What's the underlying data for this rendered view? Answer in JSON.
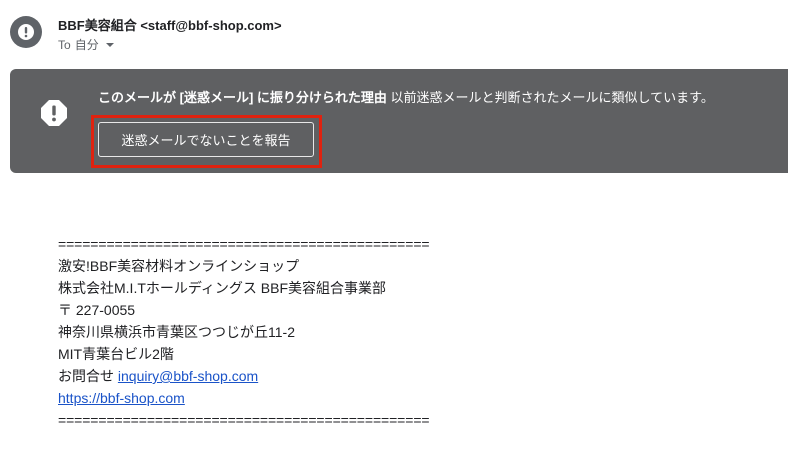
{
  "email": {
    "sender": "BBF美容組合 <staff@bbf-shop.com>",
    "to_prefix": "To",
    "to_recipient": "自分"
  },
  "spam_banner": {
    "reason_bold": "このメールが [迷惑メール] に振り分けられた理由",
    "reason_text": " 以前迷惑メールと判断されたメールに類似しています。",
    "report_button": "迷惑メールでないことを報告",
    "highlight_color": "#e0220f",
    "background_color": "#5f6062"
  },
  "body": {
    "separator_top": "==============================================",
    "line1": "激安!BBF美容材料オンラインショップ",
    "line2": "株式会社M.I.Tホールディングス BBF美容組合事業部",
    "line3": "〒 227-0055",
    "line4": "神奈川県横浜市青葉区つつじが丘11-2",
    "line5": "MIT青葉台ビル2階",
    "contact_prefix": "お問合せ ",
    "contact_email": "inquiry@bbf-shop.com",
    "website": "https://bbf-shop.com",
    "separator_bottom": "==============================================",
    "link_color": "#1a53c8"
  },
  "icons": {
    "sender_avatar": "warning-circle-icon",
    "banner_icon": "warning-octagon-icon",
    "to_dropdown": "caret-down-icon"
  }
}
